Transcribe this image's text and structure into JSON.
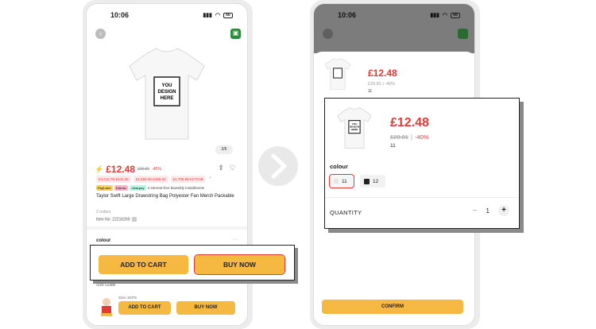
{
  "status_time": "10:06",
  "battery": "66",
  "left": {
    "design_text": [
      "YOU",
      "DESIGN",
      "HERE"
    ],
    "page_indicator": "2/5",
    "flash_icon": "flash-sale-icon",
    "price": "£12.48",
    "old_price": "£20.81",
    "discount": "-40%",
    "tiers": [
      "£3,412.75-£341.36",
      "£2,559.35-£256.02",
      "£1,705.95-£170.68"
    ],
    "bnpl_badges": [
      "PayLater",
      "Klarna.",
      "clearpay"
    ],
    "bnpl_text": "4 interest-free biweekly installments",
    "title": "Taylor Swift Large Drawstring Bag Polyester Fan Merch Packable",
    "orders": "2 orders",
    "item_no": "Item No: 22216269",
    "colour_label": "colour",
    "size_guide": "Size Guide",
    "size_text": "Size: 3CPS",
    "add_to_cart_small": "ADD TO CART",
    "buy_now_small": "BUY NOW"
  },
  "callout_left": {
    "add_to_cart": "ADD TO CART",
    "buy_now": "BUY NOW"
  },
  "right": {
    "sheet_price": "£12.48",
    "sheet_old": "£20.81 | -40%",
    "sheet_qty": "11",
    "confirm": "CONFIRM"
  },
  "callout_right": {
    "price": "£12.48",
    "old_price": "£20.81",
    "separator": "|",
    "discount": "-40%",
    "qty": "11",
    "colour_label": "colour",
    "swatches": [
      {
        "label": "11",
        "selected": true
      },
      {
        "label": "12",
        "selected": false
      }
    ],
    "quantity_label": "QUANTITY",
    "quantity_value": "1",
    "minus": "−",
    "plus": "+"
  },
  "colors": {
    "accent": "#f5b942",
    "price_red": "#e53935",
    "highlight_red": "#e53935"
  }
}
